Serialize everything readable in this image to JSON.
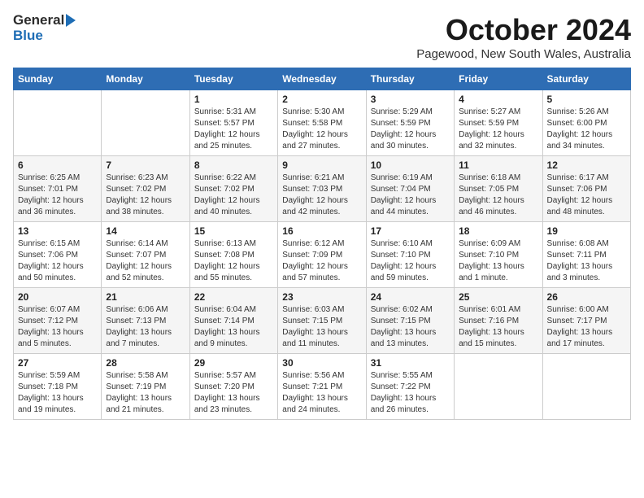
{
  "header": {
    "logo_general": "General",
    "logo_blue": "Blue",
    "main_title": "October 2024",
    "subtitle": "Pagewood, New South Wales, Australia"
  },
  "days_of_week": [
    "Sunday",
    "Monday",
    "Tuesday",
    "Wednesday",
    "Thursday",
    "Friday",
    "Saturday"
  ],
  "weeks": [
    [
      {
        "day": "",
        "info": ""
      },
      {
        "day": "",
        "info": ""
      },
      {
        "day": "1",
        "info": "Sunrise: 5:31 AM\nSunset: 5:57 PM\nDaylight: 12 hours\nand 25 minutes."
      },
      {
        "day": "2",
        "info": "Sunrise: 5:30 AM\nSunset: 5:58 PM\nDaylight: 12 hours\nand 27 minutes."
      },
      {
        "day": "3",
        "info": "Sunrise: 5:29 AM\nSunset: 5:59 PM\nDaylight: 12 hours\nand 30 minutes."
      },
      {
        "day": "4",
        "info": "Sunrise: 5:27 AM\nSunset: 5:59 PM\nDaylight: 12 hours\nand 32 minutes."
      },
      {
        "day": "5",
        "info": "Sunrise: 5:26 AM\nSunset: 6:00 PM\nDaylight: 12 hours\nand 34 minutes."
      }
    ],
    [
      {
        "day": "6",
        "info": "Sunrise: 6:25 AM\nSunset: 7:01 PM\nDaylight: 12 hours\nand 36 minutes."
      },
      {
        "day": "7",
        "info": "Sunrise: 6:23 AM\nSunset: 7:02 PM\nDaylight: 12 hours\nand 38 minutes."
      },
      {
        "day": "8",
        "info": "Sunrise: 6:22 AM\nSunset: 7:02 PM\nDaylight: 12 hours\nand 40 minutes."
      },
      {
        "day": "9",
        "info": "Sunrise: 6:21 AM\nSunset: 7:03 PM\nDaylight: 12 hours\nand 42 minutes."
      },
      {
        "day": "10",
        "info": "Sunrise: 6:19 AM\nSunset: 7:04 PM\nDaylight: 12 hours\nand 44 minutes."
      },
      {
        "day": "11",
        "info": "Sunrise: 6:18 AM\nSunset: 7:05 PM\nDaylight: 12 hours\nand 46 minutes."
      },
      {
        "day": "12",
        "info": "Sunrise: 6:17 AM\nSunset: 7:06 PM\nDaylight: 12 hours\nand 48 minutes."
      }
    ],
    [
      {
        "day": "13",
        "info": "Sunrise: 6:15 AM\nSunset: 7:06 PM\nDaylight: 12 hours\nand 50 minutes."
      },
      {
        "day": "14",
        "info": "Sunrise: 6:14 AM\nSunset: 7:07 PM\nDaylight: 12 hours\nand 52 minutes."
      },
      {
        "day": "15",
        "info": "Sunrise: 6:13 AM\nSunset: 7:08 PM\nDaylight: 12 hours\nand 55 minutes."
      },
      {
        "day": "16",
        "info": "Sunrise: 6:12 AM\nSunset: 7:09 PM\nDaylight: 12 hours\nand 57 minutes."
      },
      {
        "day": "17",
        "info": "Sunrise: 6:10 AM\nSunset: 7:10 PM\nDaylight: 12 hours\nand 59 minutes."
      },
      {
        "day": "18",
        "info": "Sunrise: 6:09 AM\nSunset: 7:10 PM\nDaylight: 13 hours\nand 1 minute."
      },
      {
        "day": "19",
        "info": "Sunrise: 6:08 AM\nSunset: 7:11 PM\nDaylight: 13 hours\nand 3 minutes."
      }
    ],
    [
      {
        "day": "20",
        "info": "Sunrise: 6:07 AM\nSunset: 7:12 PM\nDaylight: 13 hours\nand 5 minutes."
      },
      {
        "day": "21",
        "info": "Sunrise: 6:06 AM\nSunset: 7:13 PM\nDaylight: 13 hours\nand 7 minutes."
      },
      {
        "day": "22",
        "info": "Sunrise: 6:04 AM\nSunset: 7:14 PM\nDaylight: 13 hours\nand 9 minutes."
      },
      {
        "day": "23",
        "info": "Sunrise: 6:03 AM\nSunset: 7:15 PM\nDaylight: 13 hours\nand 11 minutes."
      },
      {
        "day": "24",
        "info": "Sunrise: 6:02 AM\nSunset: 7:15 PM\nDaylight: 13 hours\nand 13 minutes."
      },
      {
        "day": "25",
        "info": "Sunrise: 6:01 AM\nSunset: 7:16 PM\nDaylight: 13 hours\nand 15 minutes."
      },
      {
        "day": "26",
        "info": "Sunrise: 6:00 AM\nSunset: 7:17 PM\nDaylight: 13 hours\nand 17 minutes."
      }
    ],
    [
      {
        "day": "27",
        "info": "Sunrise: 5:59 AM\nSunset: 7:18 PM\nDaylight: 13 hours\nand 19 minutes."
      },
      {
        "day": "28",
        "info": "Sunrise: 5:58 AM\nSunset: 7:19 PM\nDaylight: 13 hours\nand 21 minutes."
      },
      {
        "day": "29",
        "info": "Sunrise: 5:57 AM\nSunset: 7:20 PM\nDaylight: 13 hours\nand 23 minutes."
      },
      {
        "day": "30",
        "info": "Sunrise: 5:56 AM\nSunset: 7:21 PM\nDaylight: 13 hours\nand 24 minutes."
      },
      {
        "day": "31",
        "info": "Sunrise: 5:55 AM\nSunset: 7:22 PM\nDaylight: 13 hours\nand 26 minutes."
      },
      {
        "day": "",
        "info": ""
      },
      {
        "day": "",
        "info": ""
      }
    ]
  ]
}
